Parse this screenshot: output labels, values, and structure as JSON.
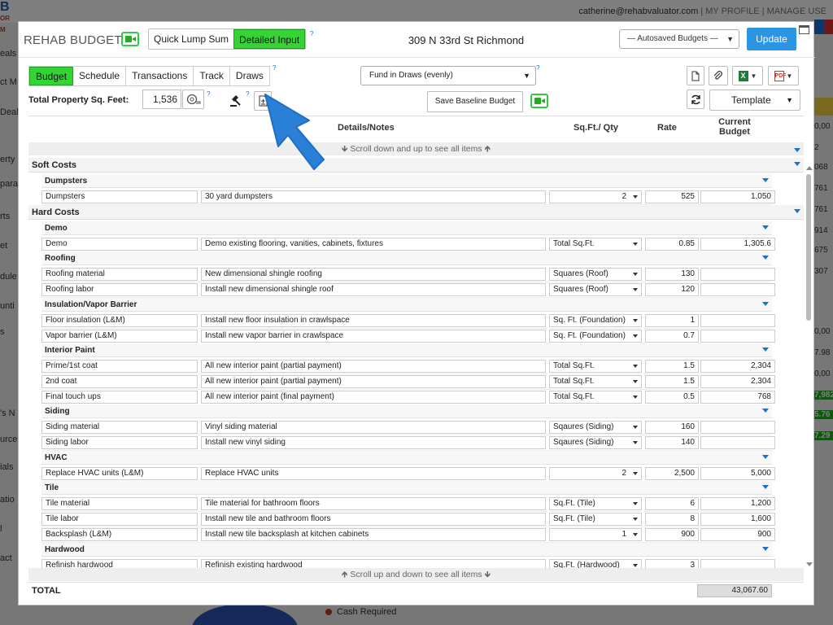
{
  "background": {
    "user_email": "catherine@rehabvaluator.com",
    "header_links": [
      "MY PROFILE",
      "MANAGE USE"
    ],
    "logo_text": "B",
    "logo_sub": "OR",
    "logo_sub2": "M",
    "left_fragments": [
      "eals",
      "ct M",
      "Deal",
      "erty",
      "para",
      "rts",
      "et",
      "dule",
      "unti",
      "s",
      "'s N",
      "urce",
      "ials",
      "atio",
      "l",
      "act"
    ],
    "right_fragments": [
      "0,00",
      "2",
      "068",
      "761",
      "761",
      "914",
      "675",
      "307",
      "0,00",
      "7.98",
      "0,00",
      "7,982",
      "5.76",
      "7.29"
    ],
    "cash_required_label": "Cash Required"
  },
  "modal": {
    "title": "REHAB BUDGET",
    "modes": [
      "Quick Lump Sum",
      "Detailed Input"
    ],
    "active_mode": "Detailed Input",
    "help_mark": "?",
    "address": "309 N 33rd St Richmond",
    "autosave_label": "— Autosaved Budgets —",
    "update_label": "Update",
    "tabs": [
      "Budget",
      "Schedule",
      "Transactions",
      "Track",
      "Draws"
    ],
    "active_tab": "Budget",
    "fund_select": "Fund in Draws (evenly)",
    "total_sqft_label": "Total Property Sq. Feet:",
    "total_sqft_value": "1,536",
    "save_baseline_label": "Save Baseline Budget",
    "template_label": "Template",
    "columns": {
      "details": "Details/Notes",
      "qty": "Sq.Ft./ Qty",
      "rate": "Rate",
      "budget_line1": "Current",
      "budget_line2": "Budget"
    },
    "scroll_note_top": "🡻 Scroll down and up to see all items 🡹",
    "scroll_note_bottom": "🡹 Scroll up and down to see all items 🡻",
    "total_label": "TOTAL",
    "total_value": "43,067.60"
  },
  "budget_rows": [
    {
      "kind": "cat",
      "label": "Soft Costs"
    },
    {
      "kind": "grp",
      "label": "Dumpsters"
    },
    {
      "kind": "item",
      "name": "Dumpsters",
      "note": "30 yard dumpsters",
      "qty": "2",
      "qty_num": true,
      "rate": "525",
      "budget": "1,050"
    },
    {
      "kind": "cat",
      "label": "Hard Costs"
    },
    {
      "kind": "grp",
      "label": "Demo"
    },
    {
      "kind": "item",
      "name": "Demo",
      "note": "Demo existing flooring, vanities, cabinets, fixtures",
      "qty": "Total Sq.Ft.",
      "qty_num": false,
      "rate": "0.85",
      "budget": "1,305.6"
    },
    {
      "kind": "grp",
      "label": "Roofing"
    },
    {
      "kind": "item",
      "name": "Roofing material",
      "note": "New dimensional shingle roofing",
      "qty": "Squares (Roof)",
      "qty_num": false,
      "rate": "130",
      "budget": ""
    },
    {
      "kind": "item",
      "name": "Roofing labor",
      "note": "Install new dimensional shingle roof",
      "qty": "Squares (Roof)",
      "qty_num": false,
      "rate": "120",
      "budget": ""
    },
    {
      "kind": "grp",
      "label": "Insulation/Vapor Barrier"
    },
    {
      "kind": "item",
      "name": "Floor insulation (L&M)",
      "note": "Install new floor insulation in crawlspace",
      "qty": "Sq. Ft. (Foundation)",
      "qty_num": false,
      "rate": "1",
      "budget": ""
    },
    {
      "kind": "item",
      "name": "Vapor barrier (L&M)",
      "note": "Install new vapor barrier in crawlspace",
      "qty": "Sq. Ft. (Foundation)",
      "qty_num": false,
      "rate": "0.7",
      "budget": ""
    },
    {
      "kind": "grp",
      "label": "Interior Paint"
    },
    {
      "kind": "item",
      "name": "Prime/1st coat",
      "note": "All new interior paint (partial payment)",
      "qty": "Total Sq.Ft.",
      "qty_num": false,
      "rate": "1.5",
      "budget": "2,304"
    },
    {
      "kind": "item",
      "name": "2nd coat",
      "note": "All new interior paint (partial payment)",
      "qty": "Total Sq.Ft.",
      "qty_num": false,
      "rate": "1.5",
      "budget": "2,304"
    },
    {
      "kind": "item",
      "name": "Final touch ups",
      "note": "All new interior paint (final payment)",
      "qty": "Total Sq.Ft.",
      "qty_num": false,
      "rate": "0.5",
      "budget": "768"
    },
    {
      "kind": "grp",
      "label": "Siding"
    },
    {
      "kind": "item",
      "name": "Siding material",
      "note": "Vinyl siding material",
      "qty": "Sqaures (Siding)",
      "qty_num": false,
      "rate": "160",
      "budget": ""
    },
    {
      "kind": "item",
      "name": "Siding labor",
      "note": "Install new vinyl siding",
      "qty": "Sqaures (Siding)",
      "qty_num": false,
      "rate": "140",
      "budget": ""
    },
    {
      "kind": "grp",
      "label": "HVAC"
    },
    {
      "kind": "item",
      "name": "Replace HVAC units (L&M)",
      "note": "Replace HVAC units",
      "qty": "2",
      "qty_num": true,
      "rate": "2,500",
      "budget": "5,000"
    },
    {
      "kind": "grp",
      "label": "Tile"
    },
    {
      "kind": "item",
      "name": "Tile material",
      "note": "Tile material for bathroom floors",
      "qty": "Sq.Ft. (Tile)",
      "qty_num": false,
      "rate": "6",
      "budget": "1,200"
    },
    {
      "kind": "item",
      "name": "Tile labor",
      "note": "Install new tile and bathroom floors",
      "qty": "Sq.Ft. (Tile)",
      "qty_num": false,
      "rate": "8",
      "budget": "1,600"
    },
    {
      "kind": "item",
      "name": "Backsplash (L&M)",
      "note": "Install new tile backsplash at kitchen cabinets",
      "qty": "1",
      "qty_num": true,
      "rate": "900",
      "budget": "900"
    },
    {
      "kind": "grp",
      "label": "Hardwood"
    },
    {
      "kind": "item",
      "name": "Refinish hardwood",
      "note": "Refinish existing hardwood",
      "qty": "Sq.Ft. (Hardwood)",
      "qty_num": false,
      "rate": "3",
      "budget": ""
    }
  ],
  "colors": {
    "active_green": "#35d435",
    "update_blue": "#2b95e3",
    "pointer_blue": "#2a7fd6"
  }
}
